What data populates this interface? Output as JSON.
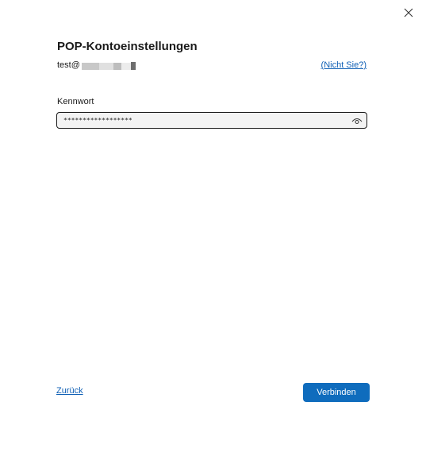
{
  "dialog": {
    "close_icon": "close-icon",
    "title": "POP-Kontoeinstellungen",
    "account": {
      "email_prefix": "test@",
      "not_you_label": "(Nicht Sie?)"
    },
    "password": {
      "label": "Kennwort",
      "value": "******************",
      "reveal_icon": "eye-icon"
    },
    "footer": {
      "back_label": "Zurück",
      "connect_label": "Verbinden"
    },
    "colors": {
      "accent": "#0f6cbd",
      "link": "#0f5fb5"
    }
  }
}
